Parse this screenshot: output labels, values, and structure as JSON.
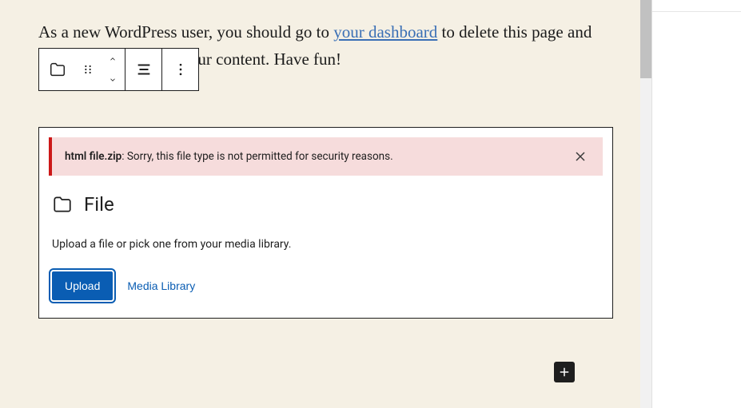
{
  "paragraph": {
    "before_link": "As a new WordPress user, you should go to ",
    "link_text": "your dashboard",
    "after_link": " to delete this page and create new pages for your content. Have fun!"
  },
  "toolbar": {
    "block_type": "File",
    "drag": "Drag",
    "move_up": "Move up",
    "move_down": "Move down",
    "align": "Align",
    "options": "Options"
  },
  "file_block": {
    "error": {
      "filename": "html file.zip",
      "separator": ": ",
      "message": "Sorry, this file type is not permitted for security reasons.",
      "dismiss": "Dismiss"
    },
    "title": "File",
    "instructions": "Upload a file or pick one from your media library.",
    "upload_label": "Upload",
    "media_library_label": "Media Library"
  },
  "inserter": {
    "add_label": "Add block"
  }
}
